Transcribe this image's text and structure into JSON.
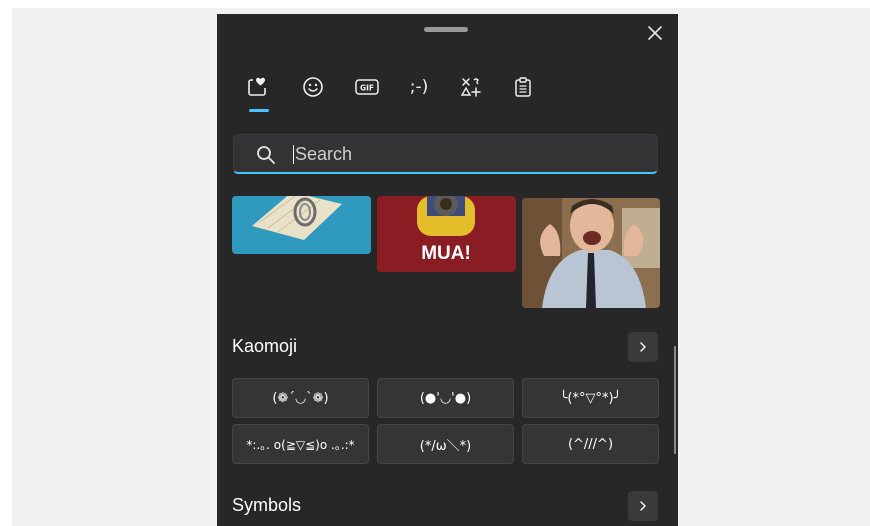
{
  "tabs": [
    {
      "icon": "favorites-heart-icon"
    },
    {
      "icon": "emoji-icon"
    },
    {
      "icon": "gif-icon",
      "label": "GIF"
    },
    {
      "icon": "kaomoji-icon",
      "label": ";-)"
    },
    {
      "icon": "symbols-icon"
    },
    {
      "icon": "clipboard-icon"
    }
  ],
  "accent_color": "#4cc2ff",
  "search": {
    "placeholder": "Search"
  },
  "gifs": [
    {
      "icon": "gif-thumbnail-paper"
    },
    {
      "icon": "gif-thumbnail-minion",
      "caption": "MUA!"
    },
    {
      "icon": "gif-thumbnail-man-cheering"
    }
  ],
  "kaomoji": {
    "title": "Kaomoji",
    "items": [
      "(❁´◡`❁)",
      "(●'◡'●)",
      "╰(*°▽°*)╯",
      "*:.｡. o(≧▽≦)o .｡.:*",
      "(*/ω＼*)",
      "(^///^)"
    ]
  },
  "symbols": {
    "title": "Symbols"
  }
}
